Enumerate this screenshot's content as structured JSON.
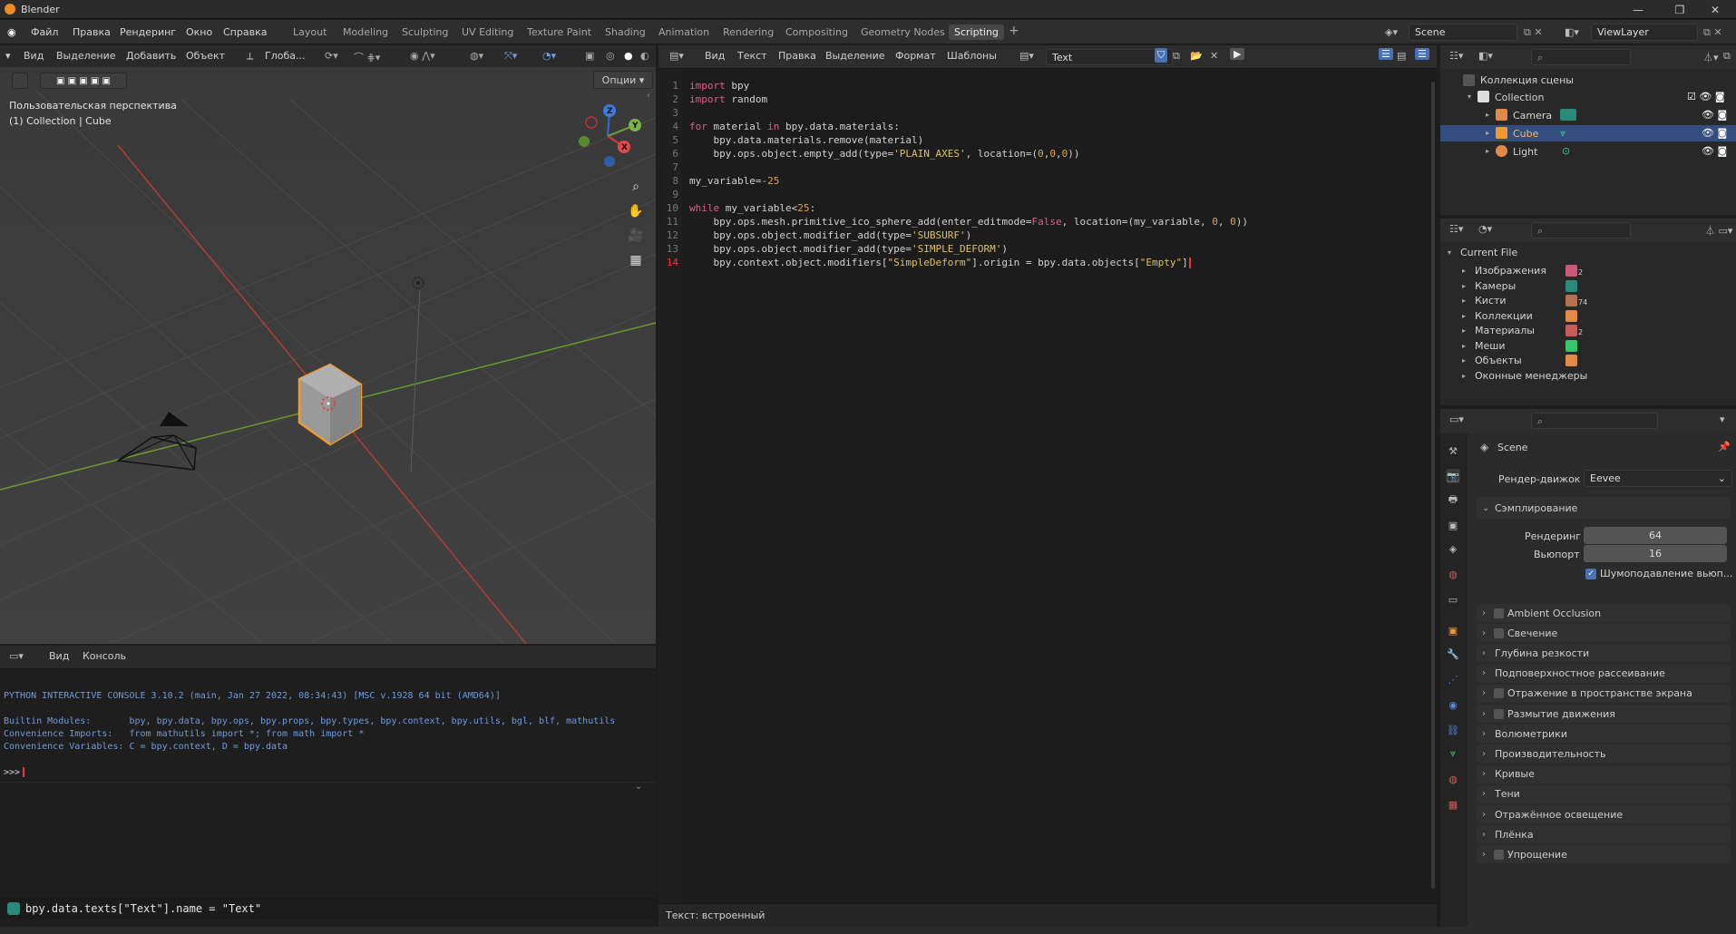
{
  "window": {
    "title": "Blender"
  },
  "menu": [
    "Файл",
    "Правка",
    "Рендеринг",
    "Окно",
    "Справка"
  ],
  "workspaces": [
    "Layout",
    "Modeling",
    "Sculpting",
    "UV Editing",
    "Texture Paint",
    "Shading",
    "Animation",
    "Rendering",
    "Compositing",
    "Geometry Nodes",
    "Scripting"
  ],
  "active_workspace": "Scripting",
  "scene": {
    "name": "Scene",
    "view_layer": "ViewLayer"
  },
  "viewport": {
    "menu": [
      "Вид",
      "Выделение",
      "Добавить",
      "Объект"
    ],
    "transform": "Глоба...",
    "options": "Опции",
    "perspective": "Пользовательская перспектива",
    "collection_info": "(1) Collection | Cube"
  },
  "console": {
    "menu": [
      "Вид",
      "Консоль"
    ],
    "lines": [
      "PYTHON INTERACTIVE CONSOLE 3.10.2 (main, Jan 27 2022, 08:34:43) [MSC v.1928 64 bit (AMD64)]",
      "",
      "Builtin Modules:       bpy, bpy.data, bpy.ops, bpy.props, bpy.types, bpy.context, bpy.utils, bgl, blf, mathutils",
      "Convenience Imports:   from mathutils import *; from math import *",
      "Convenience Variables: C = bpy.context, D = bpy.data"
    ],
    "prompt": ">>>",
    "info_line": "bpy.data.texts[\"Text\"].name = \"Text\""
  },
  "editor": {
    "menu": [
      "Вид",
      "Текст",
      "Правка",
      "Выделение",
      "Формат",
      "Шаблоны"
    ],
    "text_name": "Text",
    "footer": "Текст: встроенный",
    "lines": [
      "import bpy",
      "import random",
      "",
      "for material in bpy.data.materials:",
      "    bpy.data.materials.remove(material)",
      "    bpy.ops.object.empty_add(type='PLAIN_AXES', location=(0,0,0))",
      "",
      "my_variable=-25",
      "",
      "while my_variable<25:",
      "    bpy.ops.mesh.primitive_ico_sphere_add(enter_editmode=False, location=(my_variable, 0, 0))",
      "    bpy.ops.object.modifier_add(type='SUBSURF')",
      "    bpy.ops.object.modifier_add(type='SIMPLE_DEFORM')",
      "    bpy.context.object.modifiers[\"SimpleDeform\"].origin = bpy.data.objects[\"Empty\"]"
    ]
  },
  "outliner": {
    "scene_collection": "Коллекция сцены",
    "collection": "Collection",
    "objects": [
      "Camera",
      "Cube",
      "Light"
    ],
    "selected": "Cube"
  },
  "blend_file": {
    "root": "Current File",
    "items": [
      "Изображения",
      "Камеры",
      "Кисти",
      "Коллекции",
      "Материалы",
      "Меши",
      "Объекты",
      "Оконные менеджеры"
    ],
    "counts": {
      "images": "2",
      "brushes": "74",
      "materials": "2"
    }
  },
  "properties": {
    "scene": "Scene",
    "render_engine_label": "Рендер-движок",
    "render_engine": "Eevee",
    "sampling": "Сэмплирование",
    "render_label": "Рендеринг",
    "render_samples": "64",
    "viewport_label": "Вьюпорт",
    "viewport_samples": "16",
    "denoise": "Шумоподавление вьюп...",
    "panels": [
      {
        "label": "Ambient Occlusion",
        "checkbox": true
      },
      {
        "label": "Свечение",
        "checkbox": true
      },
      {
        "label": "Глубина резкости",
        "checkbox": false
      },
      {
        "label": "Подповерхностное рассеивание",
        "checkbox": false
      },
      {
        "label": "Отражение в пространстве экрана",
        "checkbox": true
      },
      {
        "label": "Размытие движения",
        "checkbox": true
      },
      {
        "label": "Волюметрики",
        "checkbox": false
      },
      {
        "label": "Производительность",
        "checkbox": false
      },
      {
        "label": "Кривые",
        "checkbox": false
      },
      {
        "label": "Тени",
        "checkbox": false
      },
      {
        "label": "Отражённое освещение",
        "checkbox": false
      },
      {
        "label": "Плёнка",
        "checkbox": false
      },
      {
        "label": "Упрощение",
        "checkbox": true
      }
    ]
  },
  "colors": {
    "accent": "#334d80",
    "selection_orange": "#f39a2f",
    "x_axis": "#c13a3a",
    "y_axis": "#6a9a2a"
  }
}
